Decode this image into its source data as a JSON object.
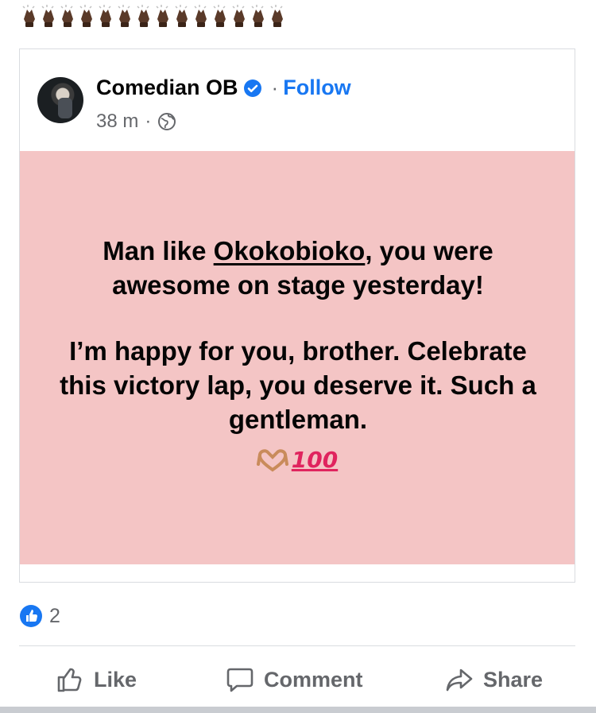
{
  "colors": {
    "accent": "#1877f2",
    "post_background": "#f4c5c5",
    "secondary_text": "#65676b"
  },
  "top_emojis": {
    "icon": "folded-hands-icon",
    "count": 14
  },
  "post": {
    "author": {
      "name": "Comedian OB",
      "verified_icon": "verified-badge-icon",
      "separator": "·",
      "follow_label": "Follow"
    },
    "meta": {
      "time": "38 m",
      "separator": "·",
      "audience_icon": "globe-icon"
    },
    "body": {
      "line1_prefix": "Man like ",
      "mention": "Okokobioko",
      "line1_suffix": ", you were awesome on stage yesterday!",
      "paragraph2": "I’m happy for you, brother. Celebrate this victory lap, you deserve it. Such a gentleman.",
      "emoji_1": "heart-hands-icon",
      "emoji_2_text": "100"
    }
  },
  "reactions": {
    "icon": "like-reaction-icon",
    "count": "2"
  },
  "actions": {
    "like_label": "Like",
    "comment_label": "Comment",
    "share_label": "Share"
  }
}
